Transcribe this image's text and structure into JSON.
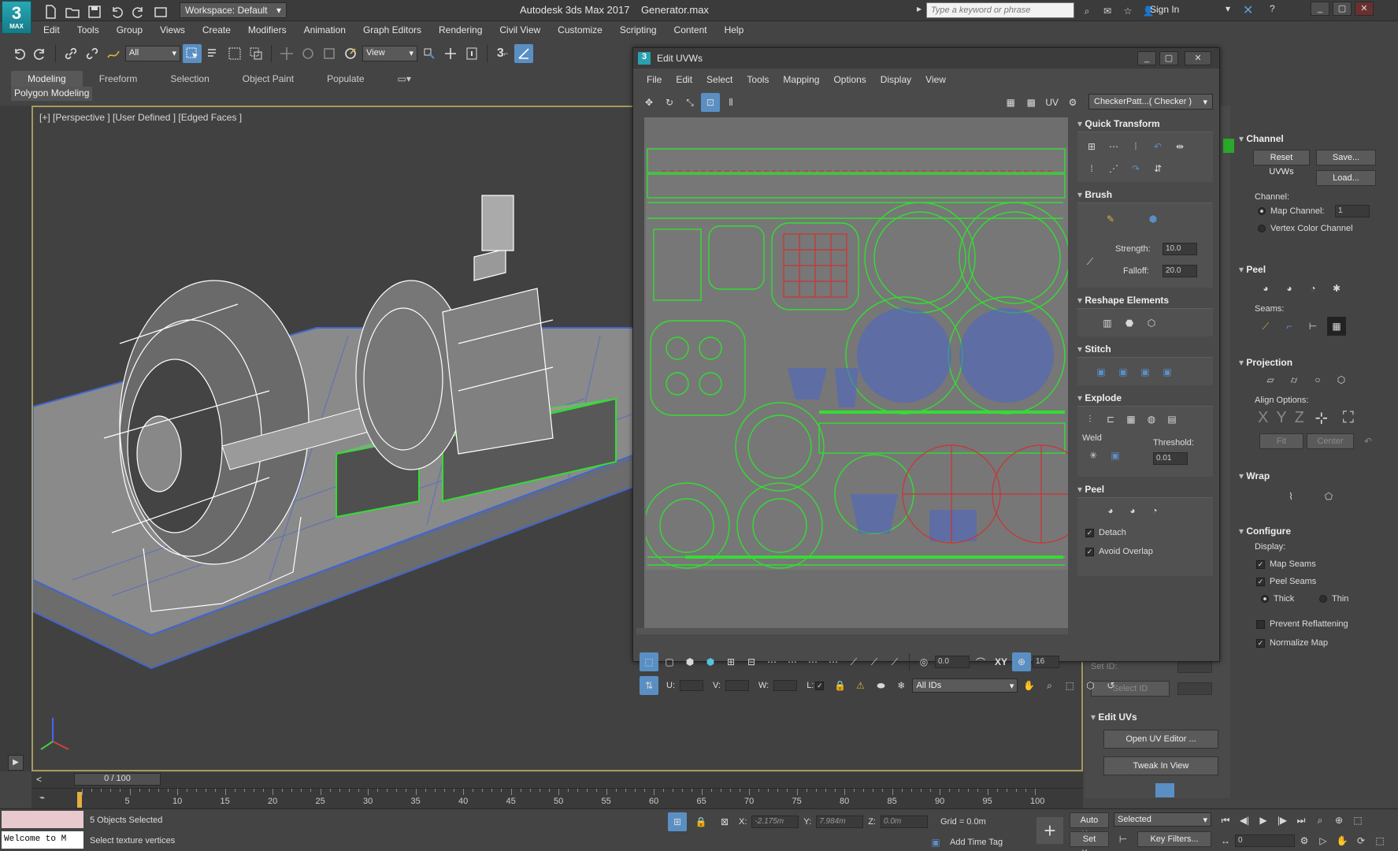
{
  "app": {
    "title": "Autodesk 3ds Max 2017",
    "file": "Generator.max",
    "logo": "3",
    "logo_sub": "MAX"
  },
  "workspace": {
    "label": "Workspace: Default"
  },
  "search": {
    "placeholder": "Type a keyword or phrase"
  },
  "account": {
    "sign_in": "Sign In"
  },
  "menus": [
    "Edit",
    "Tools",
    "Group",
    "Views",
    "Create",
    "Modifiers",
    "Animation",
    "Graph Editors",
    "Rendering",
    "Civil View",
    "Customize",
    "Scripting",
    "Content",
    "Help"
  ],
  "toolbar": {
    "selection_filter": "All",
    "ref_coord": "View"
  },
  "ribbon": {
    "tabs": [
      "Modeling",
      "Freeform",
      "Selection",
      "Object Paint",
      "Populate"
    ],
    "active": "Modeling",
    "sub": "Polygon Modeling"
  },
  "viewport": {
    "label": "[+] [Perspective ] [User Defined ] [Edged Faces ]"
  },
  "uv_editor": {
    "title": "Edit UVWs",
    "menus": [
      "File",
      "Edit",
      "Select",
      "Tools",
      "Mapping",
      "Options",
      "Display",
      "View"
    ],
    "uv_label": "UV",
    "checker": "CheckerPatt...( Checker )",
    "rollouts": {
      "quick_transform": "Quick Transform",
      "brush": "Brush",
      "strength_label": "Strength:",
      "strength": "10.0",
      "falloff_label": "Falloff:",
      "falloff": "20.0",
      "reshape": "Reshape Elements",
      "stitch": "Stitch",
      "explode": "Explode",
      "weld": "Weld",
      "threshold_label": "Threshold:",
      "threshold": "0.01",
      "peel": "Peel",
      "detach": "Detach",
      "avoid_overlap": "Avoid Overlap"
    },
    "bottom": {
      "u": "U:",
      "v": "V:",
      "w": "W:",
      "l": "L:",
      "angle": "0.0",
      "xy": "XY",
      "pixel": "16",
      "ids": "All IDs"
    }
  },
  "mid_panel": {
    "set_id": "Set ID:",
    "select_id": "Select ID",
    "edit_uvs": "Edit UVs",
    "open_uv_editor": "Open UV Editor ...",
    "tweak_in_view": "Tweak In View"
  },
  "command_panel": {
    "channel": {
      "title": "Channel",
      "reset": "Reset UVWs",
      "save": "Save...",
      "load": "Load...",
      "channel_label": "Channel:",
      "map_channel": "Map Channel:",
      "map_channel_value": "1",
      "vertex_color": "Vertex Color Channel"
    },
    "peel": {
      "title": "Peel",
      "seams": "Seams:"
    },
    "projection": {
      "title": "Projection",
      "align": "Align Options:",
      "x": "X",
      "y": "Y",
      "z": "Z",
      "fit": "Fit",
      "center": "Center"
    },
    "wrap": {
      "title": "Wrap"
    },
    "configure": {
      "title": "Configure",
      "display": "Display:",
      "map_seams": "Map Seams",
      "peel_seams": "Peel Seams",
      "thick": "Thick",
      "thin": "Thin",
      "prevent_reflattening": "Prevent Reflattening",
      "normalize_map": "Normalize Map"
    }
  },
  "timeline": {
    "slider": "0 / 100",
    "ticks": [
      "5",
      "10",
      "15",
      "20",
      "25",
      "30",
      "35",
      "40",
      "45",
      "50",
      "55",
      "60",
      "65",
      "70",
      "75",
      "80",
      "85",
      "90",
      "95",
      "100"
    ]
  },
  "status": {
    "selected": "5 Objects Selected",
    "prompt": "Select texture vertices",
    "listener": "Welcome to M",
    "x_label": "X:",
    "x": "-2.175m",
    "y_label": "Y:",
    "y": "7.984m",
    "z_label": "Z:",
    "z": "0.0m",
    "grid": "Grid = 0.0m",
    "add_time_tag": "Add Time Tag",
    "auto_key": "Auto Key",
    "set_key": "Set Key",
    "selected_dd": "Selected",
    "key_filters": "Key Filters...",
    "frame": "0"
  },
  "colors": {
    "accent": "#5a8fc4",
    "uv_green": "#33dd33",
    "uv_blue": "#4a66c8",
    "uv_red": "#cc3333",
    "viewport_border": "#a69a5a"
  }
}
